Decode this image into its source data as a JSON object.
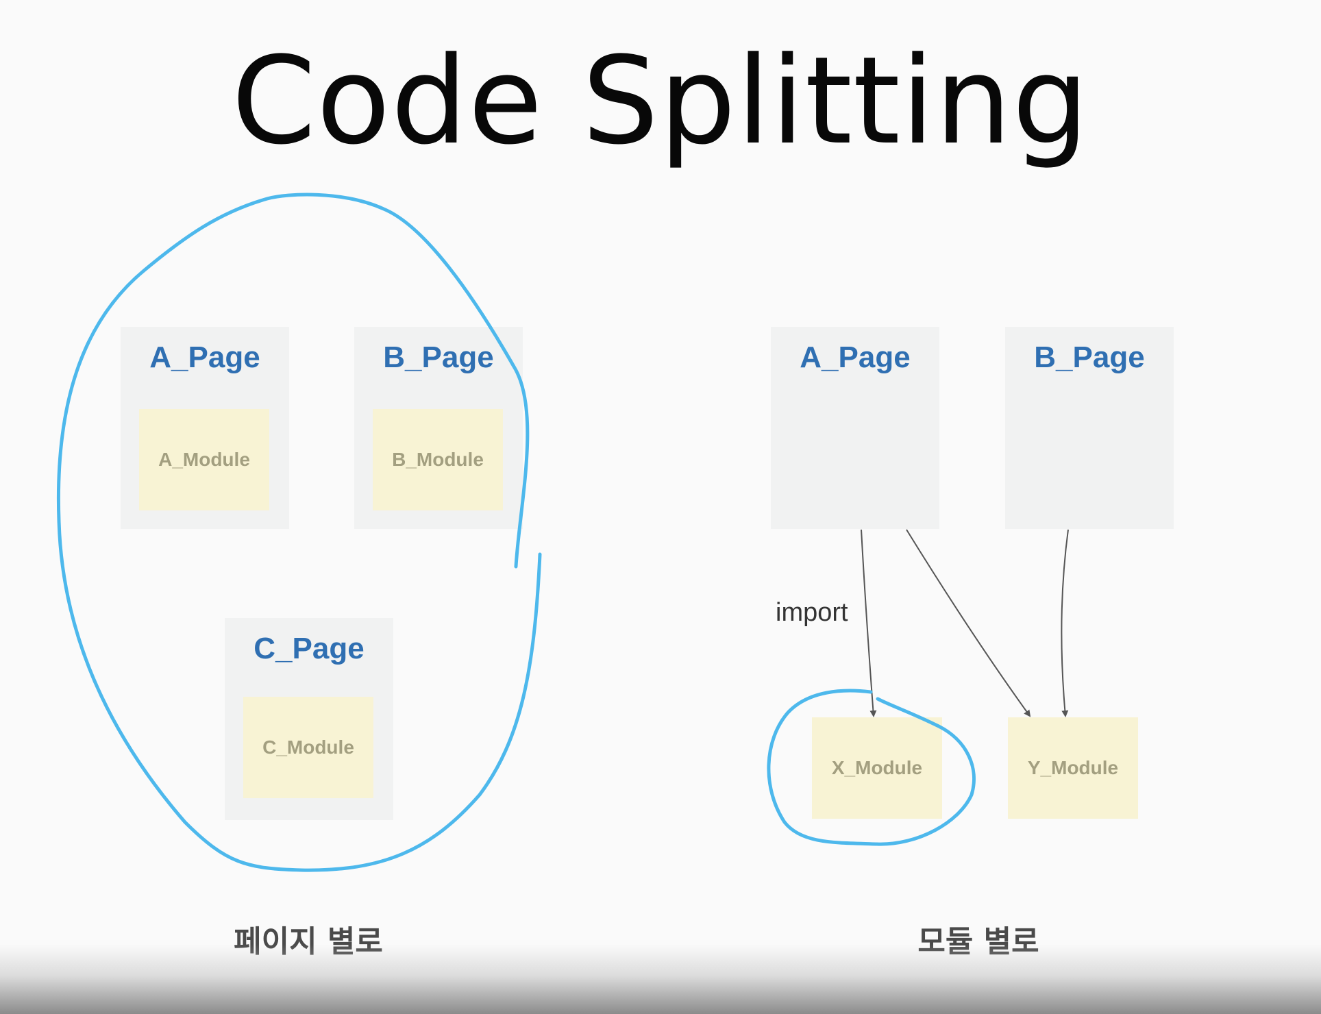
{
  "title": "Code Splitting",
  "left_panel": {
    "caption": "페이지 별로",
    "pages": [
      {
        "label": "A_Page",
        "module": "A_Module"
      },
      {
        "label": "B_Page",
        "module": "B_Module"
      },
      {
        "label": "C_Page",
        "module": "C_Module"
      }
    ]
  },
  "right_panel": {
    "caption": "모듈 별로",
    "pages": [
      {
        "label": "A_Page"
      },
      {
        "label": "B_Page"
      }
    ],
    "modules": [
      {
        "label": "X_Module"
      },
      {
        "label": "Y_Module"
      }
    ],
    "edge_label": "import"
  },
  "colors": {
    "page_bg": "#f1f2f2",
    "module_bg": "#f8f3d4",
    "page_label": "#2f6fb2",
    "module_label": "#a39f80",
    "highlight_stroke": "#4db8ec",
    "arrow": "#555555"
  }
}
